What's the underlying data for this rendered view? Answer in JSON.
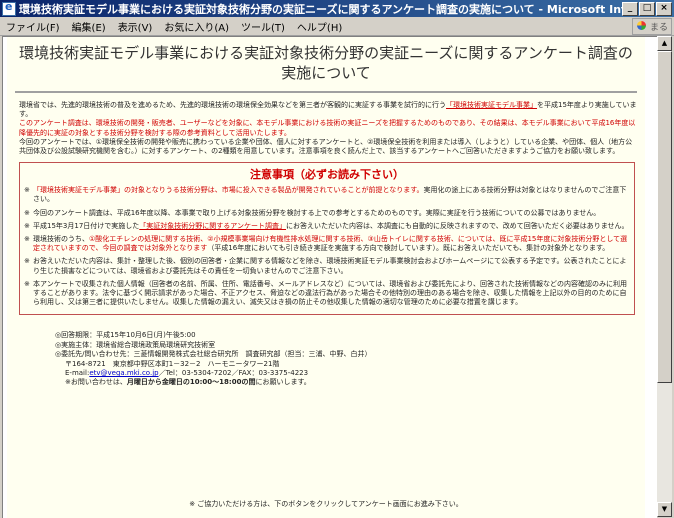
{
  "window": {
    "title": "環境技術実証モデル事業における実証対象技術分野の実証ニーズに関するアンケート調査の実施について - Microsoft Interne",
    "min": "_",
    "max": "□",
    "close": "×"
  },
  "menu": {
    "items": [
      "ファイル(F)",
      "編集(E)",
      "表示(V)",
      "お気に入り(A)",
      "ツール(T)",
      "ヘルプ(H)"
    ],
    "logo_text": "まる"
  },
  "page": {
    "title": "環境技術実証モデル事業における実証対象技術分野の実証ニーズに関するアンケート調査の実施について",
    "intro": {
      "p1_a": "環境省では、先進的環境技術の普及を進めるため、先進的環境技術の環境保全効果などを第三者が客観的に実証する事業を試行的に行う",
      "p1_link": "「環境技術実証モデル事業」",
      "p1_b": "を平成15年度より実施しています。",
      "p2_red": "このアンケート調査は、環境技術の開発・販売者、ユーザーなどを対象に、本モデル事業における技術の実証ニーズを把握するためのものであり、その結果は、本モデル事業において平成16年度以降優先的に実証の対象とする技術分野を検討する際の参考資料として活用いたします。",
      "p3": "今回のアンケートでは、①環境保全技術の開発や販売に携わっている企業や団体、個人に対するアンケートと、②環境保全技術を利用または導入（しようと）している企業、や団体、個人（地方公共団体及び公設試験研究機関を含む。）に対するアンケート、の2種類を用意しています。注意事項を良く読んだ上で、該当するアンケートへご回答いただきますようご協力をお願い致します。"
    },
    "notes": {
      "title": "注意事項（必ずお読み下さい）",
      "mark": "※",
      "n1_red": "「環境技術実証モデル事業」の対象となりうる技術分野は、市場に投入できる製品が開発されていることが前提となります。",
      "n1_rest": "実用化の途上にある技術分野は対象とはなりませんのでご注意下さい。",
      "n2": "今回のアンケート調査は、平成16年度以降、本事業で取り上げる対象技術分野を検討する上での参考とするためのものです。実際に実証を行う技術についての公募ではありません。",
      "n3_a": "平成15年3月17日付けで実施した",
      "n3_link": "「実証対象技術分野に関するアンケート調査」",
      "n3_b": "にお答えいただいた内容は、本調査にも自動的に反映されますので、改めて回答いただく必要はありません。",
      "n4_a": "環境技術のうち、",
      "n4_red": "①酸化エチレンの処理に関する技術、②小規模事業場向け有機性排水処理に関する技術、③山岳トイレに関する技術、については、既に平成15年度に対象技術分野として選定されていますので、今回の調査では対象外となります",
      "n4_b": "（平成16年度においても引き続き実証を実施する方向で検討しています）。",
      "n4_c": "既にお答えいただいても、集計の対象外となります。",
      "n5": "お答えいただいた内容は、集計・整理した後、個別の回答者・企業に関する情報などを除き、環境技術実証モデル事業検討会およびホームページにて公表する予定です。公表されたことにより生じた損害などについては、環境省および委託先はその責任を一切負いませんのでご注意下さい。",
      "n6": "本アンケートで収集された個人情報（回答者の名前、所属、住所、電話番号、メールアドレスなど）については、環境省および委託先により、回答された技術情報などの内容確認のみに利用することがあります。法令に基づく開示請求があった場合、不正アクセス、脅迫などの違法行為があった場合その他特別の理由のある場合を除き、収集した情報を上記以外の目的のために自ら利用し、又は第三者に提供いたしません。収集した情報の漏えい、滅失又はき損の防止その他収集した情報の適切な管理のために必要な措置を講じます。"
    },
    "contact": {
      "deadline": "◎回答期限：平成15年10月6日(月)午後5:00",
      "implementer": "◎実施主体：環境省総合環境政策局環境研究技術室",
      "inquiry": "◎委託先/問い合わせ先：三菱情報開発株式会社総合研究所　調査研究部（担当：三浦、中野、白井）",
      "address": "〒164-8721　東京都中野区本町1－32－2　ハーモニータワー21階",
      "email_label": "E-mail:",
      "email": "etv@vega.mki.co.jp",
      "tel": "／Tel：03-5304-7202／FAX：03-3375-4223",
      "hours_a": "※お問い合わせは、",
      "hours_bold": "月曜日から金曜日の10:00～18:00の間",
      "hours_b": "にお願いします。"
    },
    "footer": "※ ご協力いただける方は、下のボタンをクリックしてアンケート画面にお進み下さい。"
  },
  "scrollbar": {
    "up": "▲",
    "down": "▼"
  }
}
